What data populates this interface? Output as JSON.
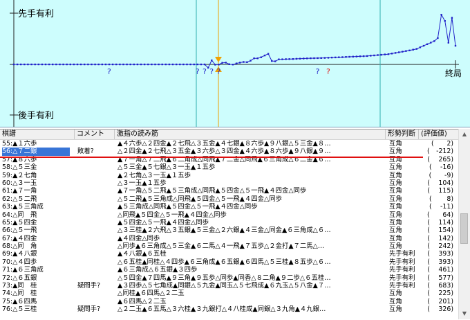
{
  "graph": {
    "label_sente": "先手有利",
    "label_gote": "後手有利",
    "label_end": "終局",
    "question_mark": "?",
    "colors": {
      "background": "#cdfdfd",
      "line": "#2020c8",
      "zero_line": "#202020",
      "marker_lines": "#30b0b0",
      "cursor_arrow": "#f0a000",
      "bad_move": "#e01010"
    }
  },
  "columns": {
    "move": "棋譜",
    "comment": "コメント",
    "line": "激指の読み筋",
    "judge": "形勢判断",
    "value": "(評価値)"
  },
  "rows": [
    {
      "move": "55:▲１六歩",
      "comment": "",
      "line": "▲４六歩△２四金▲２七飛△３五金▲４七銀▲８六歩▲９八銀△５三金▲８…",
      "judge": "互角",
      "value": "(　　2)"
    },
    {
      "move": "56:△７二銀",
      "comment": "敗着?",
      "line": "△２四金▲２七飛△３五金▲３六歩△３四金▲４六歩▲８六歩▲９八銀▲９…",
      "judge": "互角",
      "value": "(　-212)"
    },
    {
      "move": "57:▲８六歩",
      "comment": "",
      "line": "▲７一角△７二飛▲６二角成△同飛▲７二金△同飛▲６三角成△６二金▲６…",
      "judge": "互角",
      "value": "(　 265)"
    },
    {
      "move": "58:△５三金",
      "comment": "",
      "line": "△５三金▲５七銀△３一玉▲１五歩",
      "judge": "互角",
      "value": "(　 -16)"
    },
    {
      "move": "59:▲２七角",
      "comment": "",
      "line": "▲２七角△３一玉▲１五歩",
      "judge": "互角",
      "value": "(　　-9)"
    },
    {
      "move": "60:△３一玉",
      "comment": "",
      "line": "△３一玉▲１五歩",
      "judge": "互角",
      "value": "(　 104)"
    },
    {
      "move": "61:▲７一角",
      "comment": "",
      "line": "▲７一角△５二飛▲５三角成△同飛▲５四金△５一飛▲４四金△同歩",
      "judge": "互角",
      "value": "(　 115)"
    },
    {
      "move": "62:△５二飛",
      "comment": "",
      "line": "△５二飛▲５三角成△同飛▲５四金△５一飛▲４四金△同歩",
      "judge": "互角",
      "value": "(　　 8)"
    },
    {
      "move": "63:▲５三角成",
      "comment": "",
      "line": "▲５三角成△同飛▲５四金△５一飛▲４四金△同歩",
      "judge": "互角",
      "value": "(　 -11)"
    },
    {
      "move": "64:△同　飛",
      "comment": "",
      "line": "△同飛▲５四金△５一飛▲４四金△同歩",
      "judge": "互角",
      "value": "(　　64)"
    },
    {
      "move": "65:▲５四金",
      "comment": "",
      "line": "▲５四金△５一飛▲４四金△同歩",
      "judge": "互角",
      "value": "(　 114)"
    },
    {
      "move": "66:△５一飛",
      "comment": "",
      "line": "△３三桂▲２六飛△３五銀▲５三金△２六銀▲４三金△同金▲６三角成△６…",
      "judge": "互角",
      "value": "(　 154)"
    },
    {
      "move": "67:▲４四金",
      "comment": "",
      "line": "▲４四金△同歩",
      "judge": "互角",
      "value": "(　 142)"
    },
    {
      "move": "68:△同　角",
      "comment": "",
      "line": "△同歩▲６三角成△５三金▲６二馬△４一飛▲７五歩△２金打▲７二馬△…",
      "judge": "互角",
      "value": "(　 242)"
    },
    {
      "move": "69:▲４八銀",
      "comment": "",
      "line": "▲４八銀▲６五桂",
      "judge": "先手有利",
      "value": "(　 393)"
    },
    {
      "move": "70:△４四歩",
      "comment": "",
      "line": "△６五桂▲同桂△４四歩▲６三角成▲６五銀▲６四馬△５三桂▲８五歩△６…",
      "judge": "先手有利",
      "value": "(　 393)"
    },
    {
      "move": "71:▲６三角成",
      "comment": "",
      "line": "▲６三角成△６五銀▲３四歩",
      "judge": "先手有利",
      "value": "(　 461)"
    },
    {
      "move": "72:△６五銀",
      "comment": "",
      "line": "△５四金▲７四馬▲９三角▲９五歩△同歩▲同香△８二角▲９二歩△６五桂…",
      "judge": "先手有利",
      "value": "(　 577)"
    },
    {
      "move": "73:▲同　桂",
      "comment": "疑問手?",
      "line": "▲３四歩△５七角成▲同銀△５九金▲同玉△５七飛成▲６九玉△５八金▲７…",
      "judge": "先手有利",
      "value": "(　 683)"
    },
    {
      "move": "74:△同　桂",
      "comment": "",
      "line": "△同桂▲６四馬△２二玉",
      "judge": "互角",
      "value": "(　 225)"
    },
    {
      "move": "75:▲６四馬",
      "comment": "",
      "line": "▲６四馬△２二玉",
      "judge": "互角",
      "value": "(　 201)"
    },
    {
      "move": "76:△５三桂",
      "comment": "疑問手?",
      "line": "△２二玉▲６五馬△３六桂▲３九銀打△４八桂成▲同銀△３九角▲４九銀…",
      "judge": "互角",
      "value": "(　 326)"
    }
  ],
  "selected_row": 1,
  "series": {
    "values": [
      0,
      0,
      0,
      0,
      0,
      0,
      0,
      0,
      0,
      0,
      0,
      0,
      0,
      0,
      0,
      0,
      0,
      0,
      0,
      0,
      0,
      0,
      0,
      0,
      0,
      0,
      0,
      0,
      0,
      0,
      0,
      0,
      0,
      0,
      0,
      0,
      0,
      0,
      0,
      0,
      0,
      0,
      0,
      0,
      0,
      0,
      0,
      0,
      0,
      0,
      0,
      0,
      0,
      0,
      0,
      -212,
      265,
      -16,
      -9,
      104,
      115,
      8,
      -11,
      64,
      114,
      154,
      142,
      242,
      393,
      393,
      461,
      577,
      683,
      225,
      201,
      326,
      330,
      340,
      345,
      350,
      360,
      370,
      380,
      390,
      395,
      400,
      405,
      410,
      420,
      430,
      440,
      450,
      460,
      470,
      480,
      490,
      500,
      510,
      520,
      530,
      540,
      560,
      580,
      600,
      620,
      640,
      660,
      700,
      740,
      780,
      820,
      860,
      900,
      950,
      1000,
      1100,
      1200,
      1300,
      1400,
      1500,
      1700,
      3200,
      2800,
      1400,
      3000,
      1200
    ],
    "range": [
      -3300,
      3300
    ]
  }
}
